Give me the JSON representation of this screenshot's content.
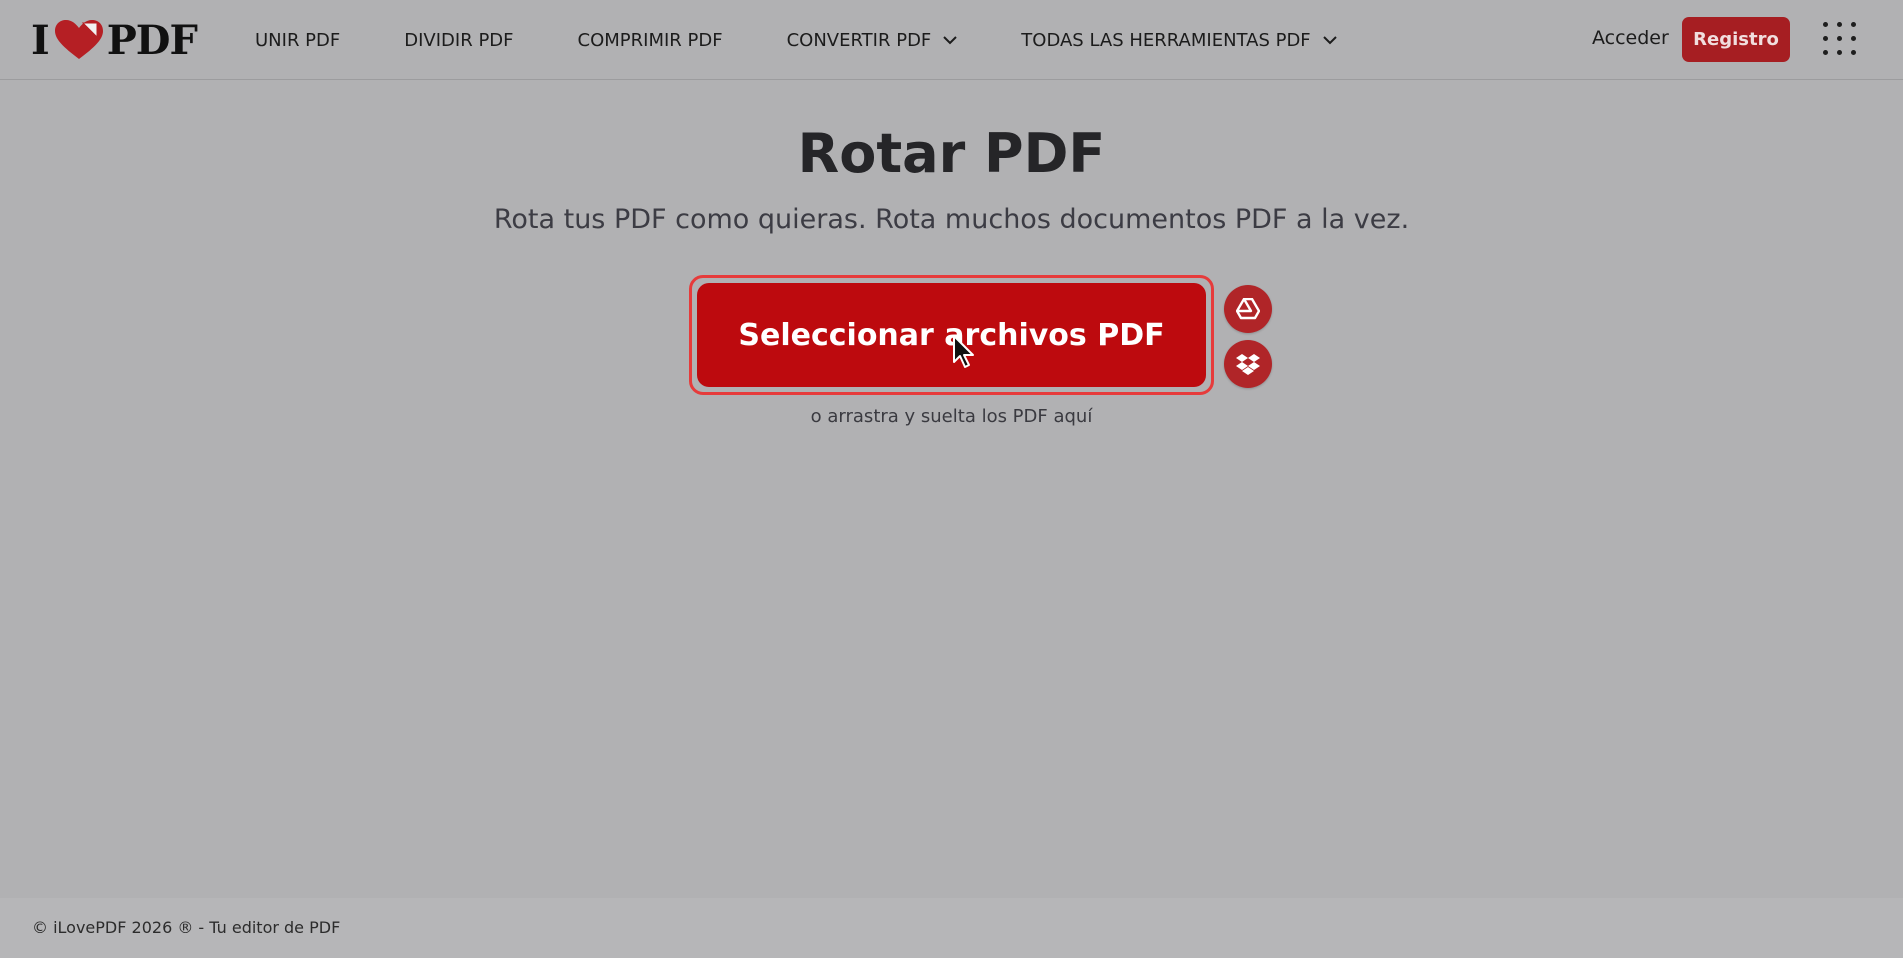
{
  "header": {
    "logo_left": "I",
    "logo_right": "PDF",
    "nav": [
      {
        "label": "UNIR PDF",
        "dropdown": false
      },
      {
        "label": "DIVIDIR PDF",
        "dropdown": false
      },
      {
        "label": "COMPRIMIR PDF",
        "dropdown": false
      },
      {
        "label": "CONVERTIR PDF",
        "dropdown": true
      },
      {
        "label": "TODAS LAS HERRAMIENTAS PDF",
        "dropdown": true
      }
    ],
    "login_label": "Acceder",
    "register_label": "Registro"
  },
  "main": {
    "title": "Rotar PDF",
    "subtitle": "Rota tus PDF como quieras. Rota muchos documentos PDF a la vez.",
    "select_button": "Seleccionar archivos PDF",
    "drop_hint": "o arrastra y suelta los PDF aquí",
    "cloud_icons": [
      "google-drive-icon",
      "dropbox-icon"
    ]
  },
  "footer": {
    "text": "© iLovePDF 2026 ® - Tu editor de PDF"
  },
  "colors": {
    "brand_red": "#bd0a0e",
    "register_red": "#a61e22",
    "overlay_gray": "#b1b1b3"
  }
}
